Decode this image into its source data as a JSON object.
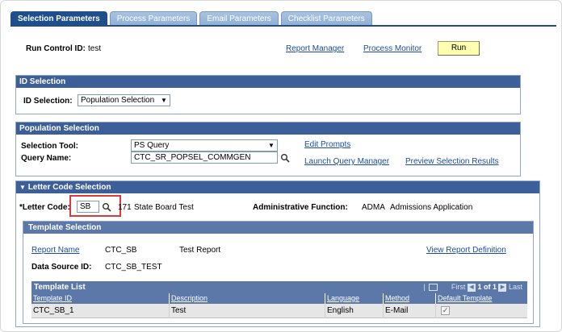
{
  "tabs": [
    {
      "label": "Selection Parameters",
      "active": true
    },
    {
      "label": "Process Parameters",
      "active": false
    },
    {
      "label": "Email Parameters",
      "active": false
    },
    {
      "label": "Checklist Parameters",
      "active": false
    }
  ],
  "header": {
    "run_control_label": "Run Control ID:",
    "run_control_value": "test",
    "report_manager": "Report Manager",
    "process_monitor": "Process Monitor",
    "run_button": "Run"
  },
  "id_selection": {
    "title": "ID Selection",
    "label": "ID Selection:",
    "value": "Population Selection"
  },
  "population_selection": {
    "title": "Population Selection",
    "tool_label": "Selection Tool:",
    "tool_value": "PS Query",
    "query_label": "Query Name:",
    "query_value": "CTC_SR_POPSEL_COMMGEN",
    "edit_prompts": "Edit Prompts",
    "launch_query_manager": "Launch Query Manager",
    "preview_results": "Preview Selection Results"
  },
  "letter_code_selection": {
    "title": "Letter Code Selection",
    "letter_code_label": "*Letter Code:",
    "letter_code_value": "SB",
    "letter_code_num": "171",
    "letter_code_desc": "State Board Test",
    "admin_function_label": "Administrative Function:",
    "admin_function_code": "ADMA",
    "admin_function_desc": "Admissions Application"
  },
  "template_selection": {
    "title": "Template Selection",
    "report_name_link": "Report Name",
    "report_name_value": "CTC_SB",
    "report_name_desc": "Test Report",
    "view_report_definition": "View Report Definition",
    "data_source_label": "Data Source ID:",
    "data_source_value": "CTC_SB_TEST"
  },
  "template_list": {
    "title": "Template List",
    "nav_first": "First",
    "nav_range": "1 of 1",
    "nav_last": "Last",
    "columns": [
      "Template ID",
      "Description",
      "Language",
      "Method",
      "Default Template"
    ],
    "rows": [
      {
        "template_id": "CTC_SB_1",
        "description": "Test",
        "language": "English",
        "method": "E-Mail",
        "default": true
      }
    ]
  },
  "colors": {
    "section_header": "#3d5f99",
    "tab_active": "#1f4e8c",
    "link": "#1a4da1",
    "highlight": "#d93a3a"
  }
}
